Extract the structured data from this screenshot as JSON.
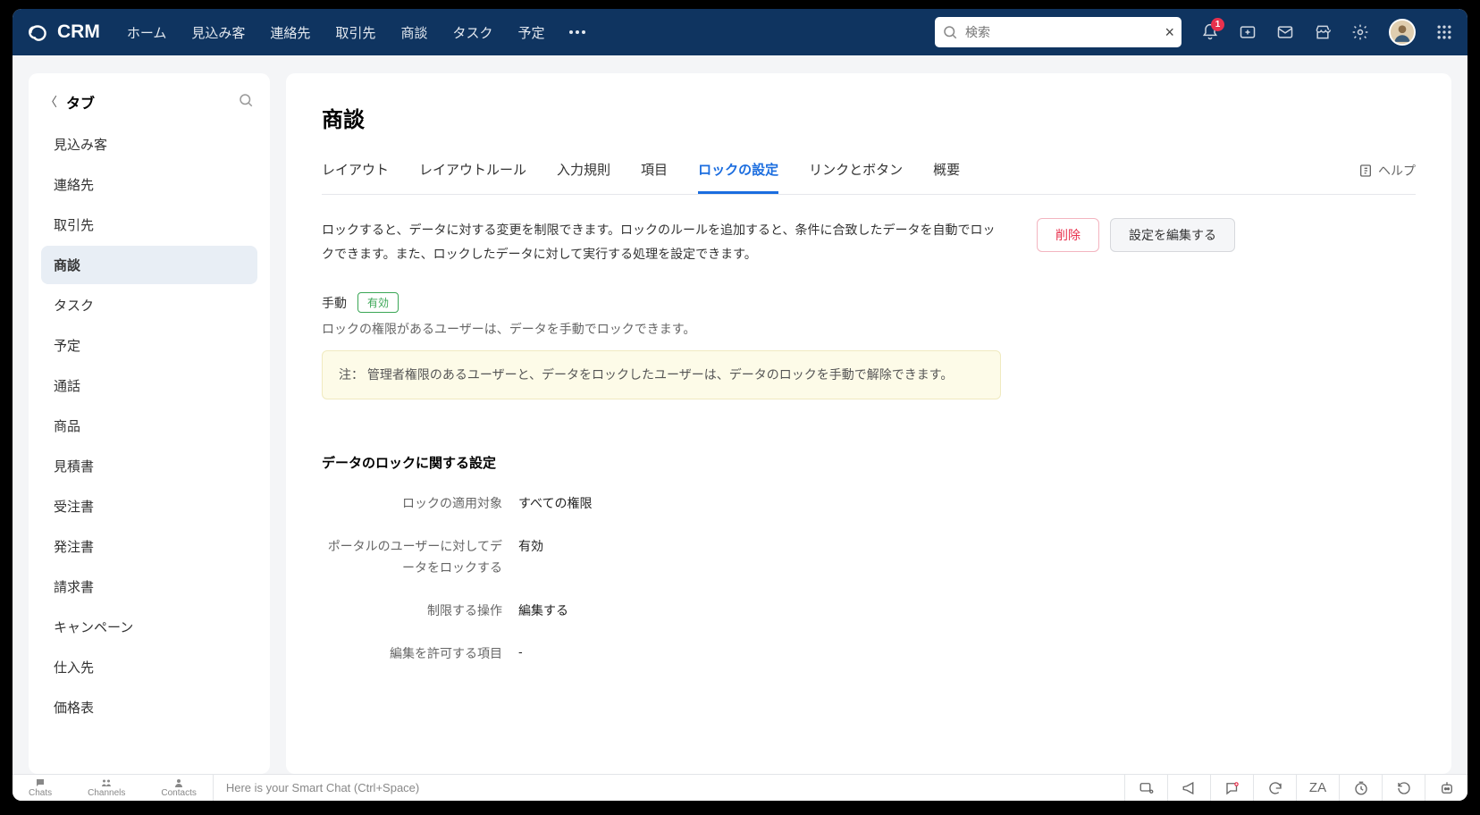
{
  "app": {
    "name": "CRM"
  },
  "nav": {
    "items": [
      "ホーム",
      "見込み客",
      "連絡先",
      "取引先",
      "商談",
      "タスク",
      "予定"
    ]
  },
  "search": {
    "placeholder": "検索"
  },
  "notifications": {
    "count": "1"
  },
  "sidebar": {
    "title": "タブ",
    "items": [
      "見込み客",
      "連絡先",
      "取引先",
      "商談",
      "タスク",
      "予定",
      "通話",
      "商品",
      "見積書",
      "受注書",
      "発注書",
      "請求書",
      "キャンペーン",
      "仕入先",
      "価格表"
    ],
    "active_index": 3
  },
  "page": {
    "title": "商談",
    "tabs": [
      "レイアウト",
      "レイアウトルール",
      "入力規則",
      "項目",
      "ロックの設定",
      "リンクとボタン",
      "概要"
    ],
    "active_tab_index": 4,
    "help": "ヘルプ"
  },
  "lock": {
    "intro": "ロックすると、データに対する変更を制限できます。ロックのルールを追加すると、条件に合致したデータを自動でロックできます。また、ロックしたデータに対して実行する処理を設定できます。",
    "delete_btn": "削除",
    "edit_btn": "設定を編集する",
    "manual_label": "手動",
    "manual_status": "有効",
    "manual_desc": "ロックの権限があるユーザーは、データを手動でロックできます。",
    "note": "注： 管理者権限のあるユーザーと、データをロックしたユーザーは、データのロックを手動で解除できます。",
    "settings_title": "データのロックに関する設定",
    "rows": [
      {
        "label": "ロックの適用対象",
        "value": "すべての権限"
      },
      {
        "label": "ポータルのユーザーに対してデータをロックする",
        "value": "有効"
      },
      {
        "label": "制限する操作",
        "value": "編集する"
      },
      {
        "label": "編集を許可する項目",
        "value": "-"
      }
    ]
  },
  "footer": {
    "chats": "Chats",
    "channels": "Channels",
    "contacts": "Contacts",
    "msg": "Here is your Smart Chat (Ctrl+Space)"
  }
}
